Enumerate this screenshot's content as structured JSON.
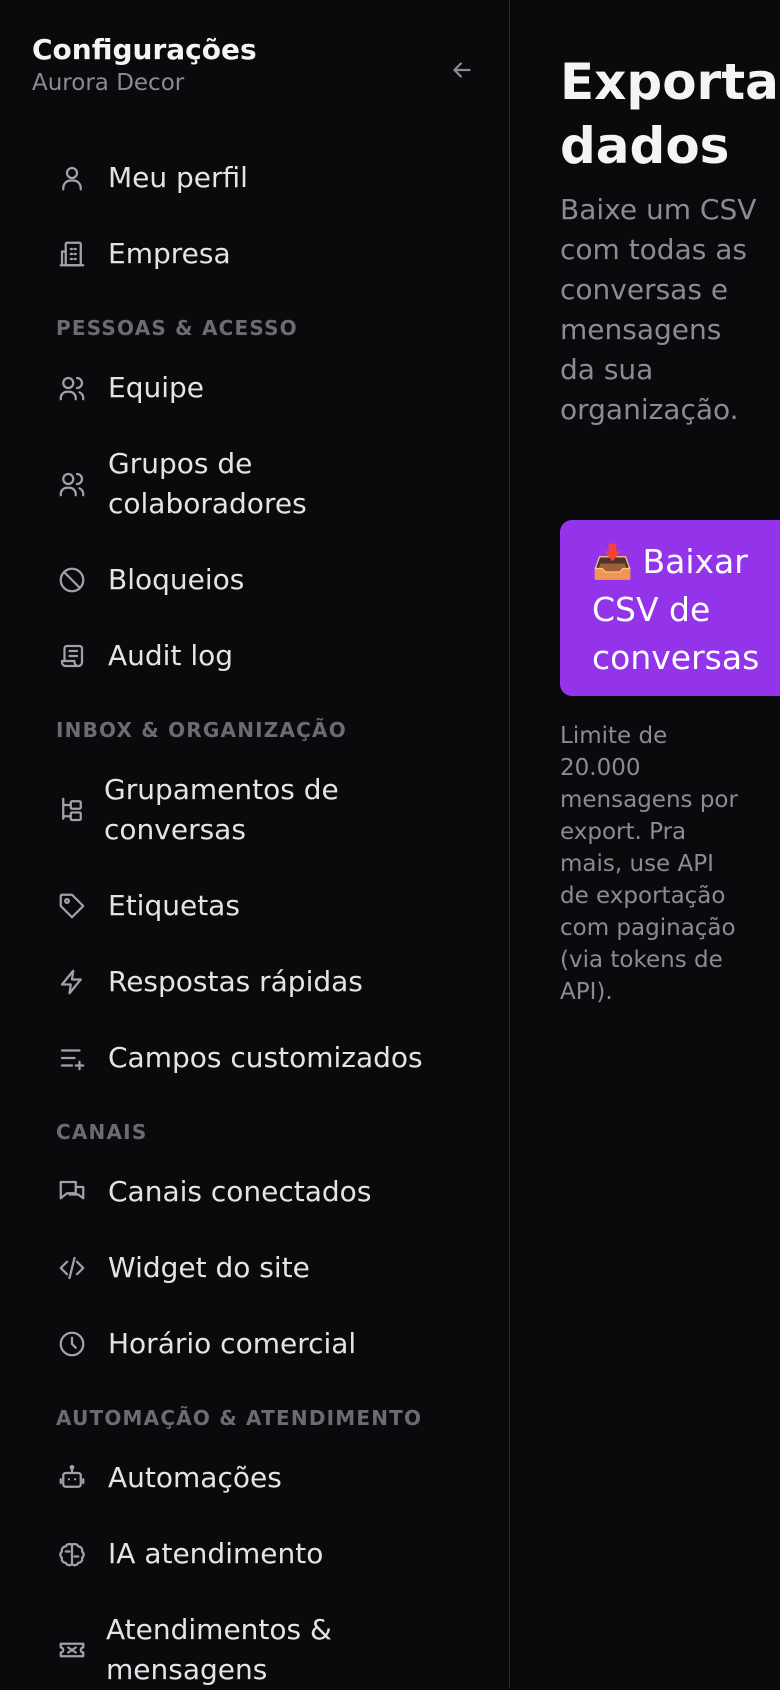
{
  "sidebar": {
    "title": "Configurações",
    "subtitle": "Aurora Decor",
    "items": {
      "meu_perfil": "Meu perfil",
      "empresa": "Empresa",
      "equipe": "Equipe",
      "grupos_line1": "Grupos de",
      "grupos_line2": "colaboradores",
      "bloqueios": "Bloqueios",
      "audit_log": "Audit log",
      "grupamentos_line1": "Grupamentos de",
      "grupamentos_line2": "conversas",
      "etiquetas": "Etiquetas",
      "respostas": "Respostas rápidas",
      "campos": "Campos customizados",
      "canais_conectados": "Canais conectados",
      "widget": "Widget do site",
      "horario": "Horário comercial",
      "automacoes": "Automações",
      "ia": "IA atendimento",
      "atend_line1": "Atendimentos &",
      "atend_line2": "mensagens"
    },
    "sections": {
      "pessoas": "PESSOAS & ACESSO",
      "inbox": "INBOX & ORGANIZAÇÃO",
      "canais": "CANAIS",
      "automacao": "AUTOMAÇÃO & ATENDIMENTO"
    },
    "icons": [
      "arrow-left-icon",
      "user-icon",
      "building-icon",
      "users-icon",
      "users-group-icon",
      "ban-icon",
      "scroll-icon",
      "hierarchy-icon",
      "tag-icon",
      "bolt-icon",
      "list-plus-icon",
      "messages-icon",
      "code-icon",
      "clock-icon",
      "robot-icon",
      "brain-icon",
      "ticket-icon"
    ]
  },
  "main": {
    "title_line1": "Exportar",
    "title_line2": "dados",
    "description": "Baixe um CSV com todas as conversas e mensagens da sua organização.",
    "download_emoji": "📥",
    "download_line1": "Baixar",
    "download_line2": "CSV de",
    "download_line3": "conversas",
    "note": "Limite de 20.000 mensagens por export. Pra mais, use API de exportação com paginação (via tokens de API).",
    "accent_color": "#9333ea"
  }
}
